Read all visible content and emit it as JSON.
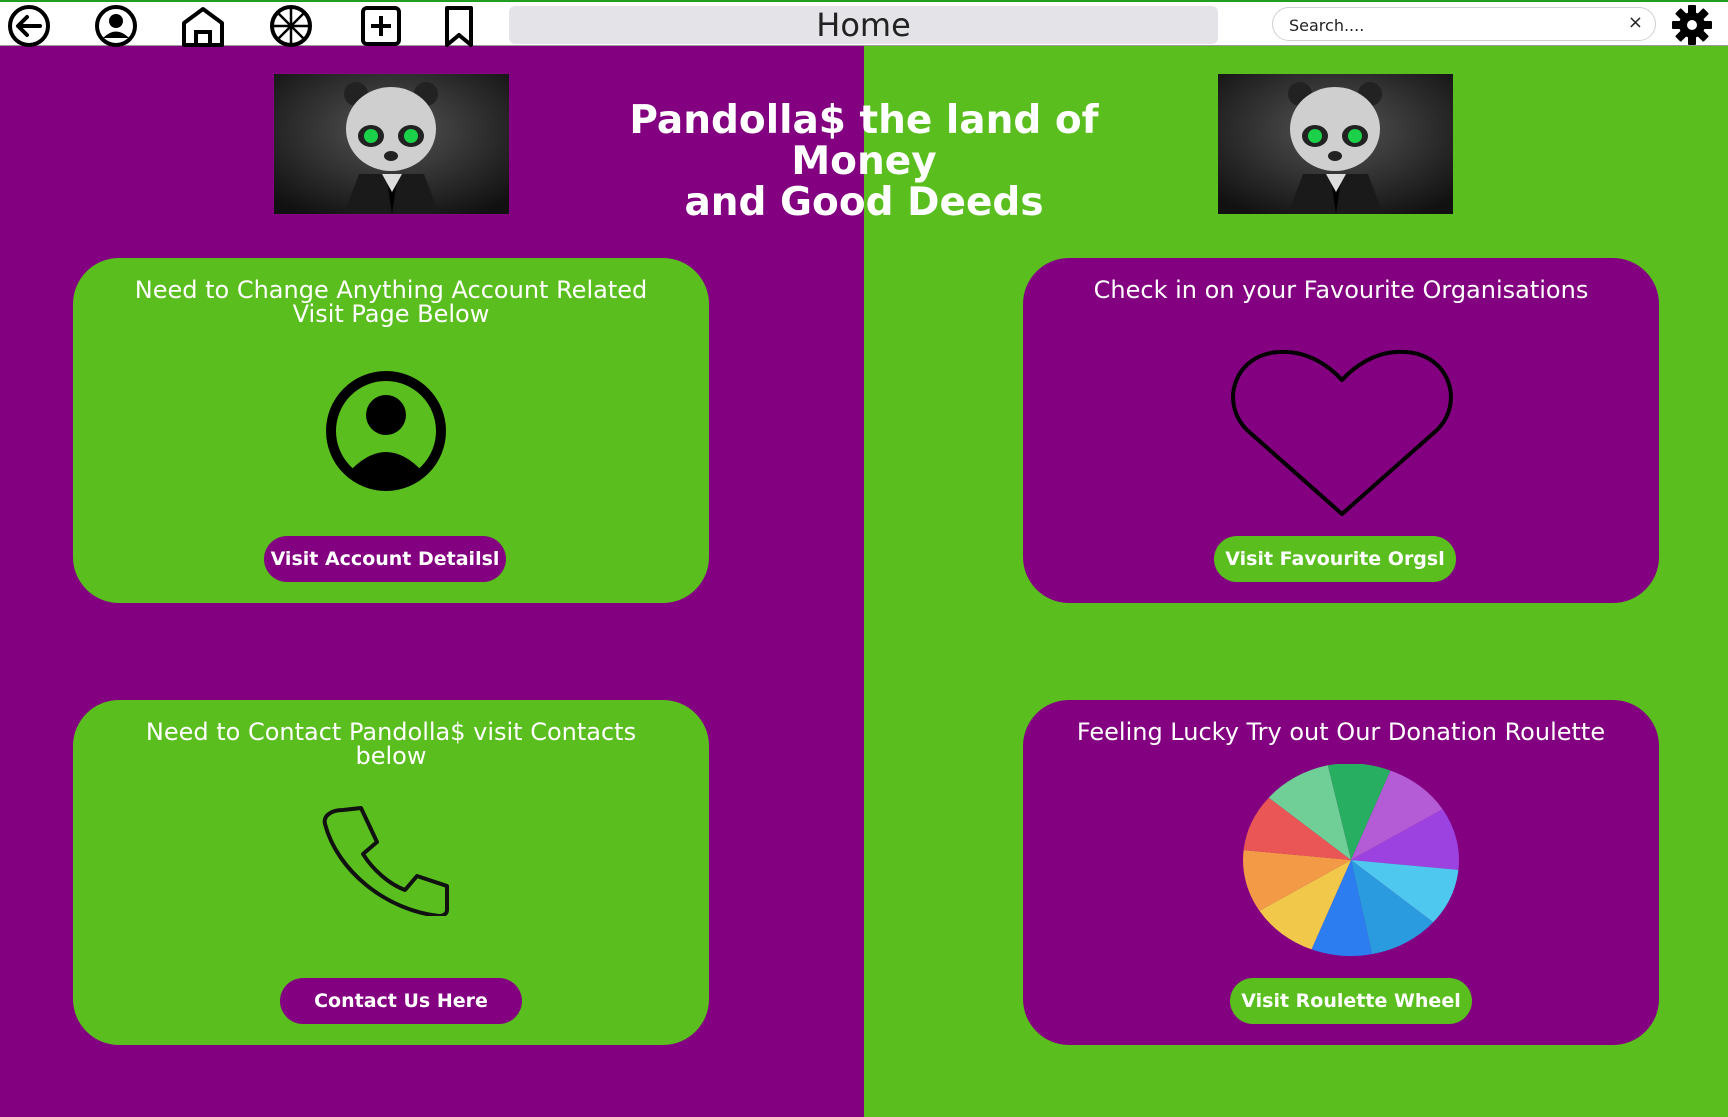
{
  "colors": {
    "purple": "#830081",
    "green": "#59be1e"
  },
  "toolbar": {
    "icons": [
      "back-arrow-icon",
      "account-icon",
      "home-icon",
      "roulette-icon",
      "add-icon",
      "bookmark-icon",
      "gear-icon"
    ],
    "title": "Home",
    "search": {
      "placeholder": "Search....",
      "value": "",
      "clear": "×"
    }
  },
  "banner": {
    "headline_line1": "Pandolla$ the land of Money",
    "headline_line2": "and Good Deeds",
    "image": "panda-in-suit-with-dollar-eyes"
  },
  "cards": {
    "account": {
      "title": "Need to Change Anything Account Related Visit Page Below",
      "icon": "account-circle-icon",
      "button": "Visit Account Detailsl"
    },
    "favourites": {
      "title": "Check in on your Favourite Organisations",
      "icon": "heart-icon",
      "button": "Visit Favourite Orgsl"
    },
    "contact": {
      "title": "Need to Contact Pandolla$ visit Contacts below",
      "icon": "phone-icon",
      "button": "Contact Us Here"
    },
    "roulette": {
      "title": "Feeling Lucky Try out Our Donation Roulette",
      "icon": "roulette-wheel-icon",
      "button": "Visit Roulette Wheel"
    }
  }
}
